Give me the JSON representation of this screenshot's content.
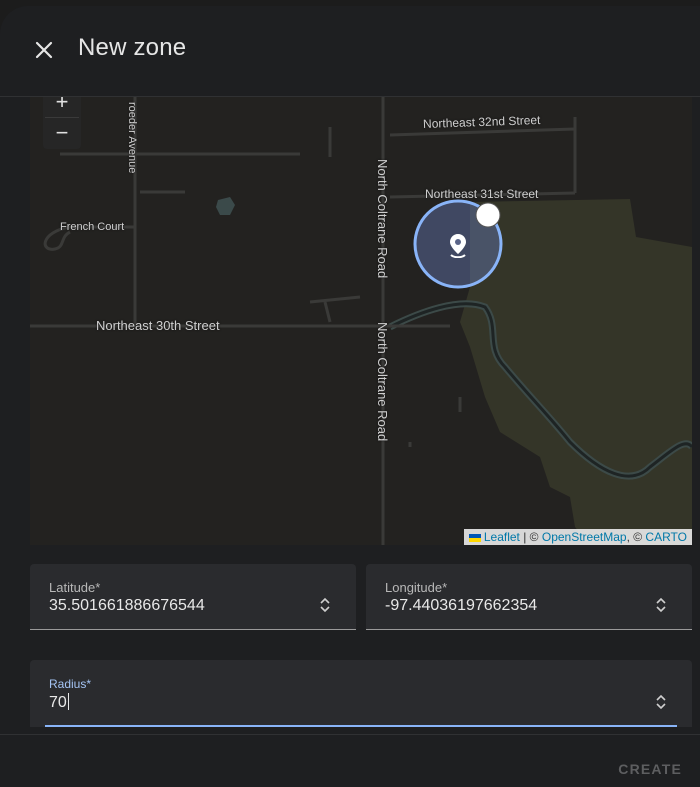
{
  "dialog": {
    "title": "New zone",
    "close_icon": "close-icon"
  },
  "map": {
    "zoom_in": "+",
    "zoom_out": "−",
    "labels": {
      "ne32": "Northeast 32nd Street",
      "ne31": "Northeast 31st Street",
      "ne30": "Northeast 30th Street",
      "french": "French Court",
      "roeder": "roeder Avenue",
      "coltrane1": "North Coltrane Road",
      "coltrane2": "North Coltrane Road"
    },
    "attribution": {
      "leaflet": "Leaflet",
      "sep1": " | © ",
      "osm": "OpenStreetMap",
      "sep2": ", © ",
      "carto": "CARTO"
    },
    "marker_icon": "map-marker-icon"
  },
  "form": {
    "latitude": {
      "label": "Latitude*",
      "value": "35.501661886676544"
    },
    "longitude": {
      "label": "Longitude*",
      "value": "-97.44036197662354"
    },
    "radius": {
      "label": "Radius*",
      "value": "70"
    }
  },
  "footer": {
    "create_label": "CREATE"
  },
  "colors": {
    "accent": "#89b4f8",
    "background": "#1e1f21",
    "field_bg": "#2a2b2e",
    "park": "#343528"
  }
}
